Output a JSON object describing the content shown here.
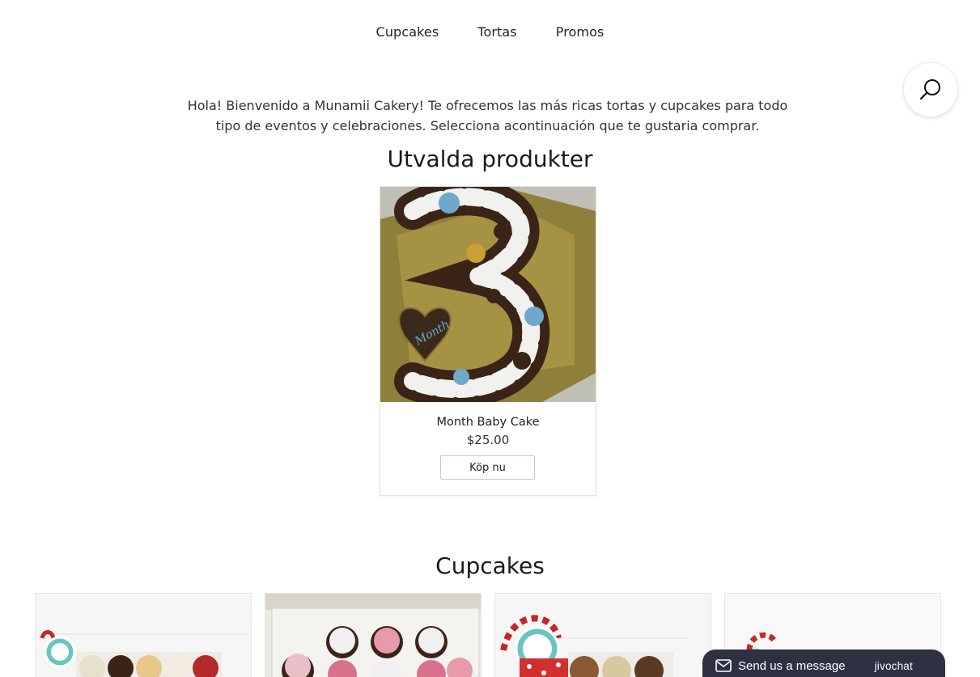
{
  "nav": {
    "items": [
      {
        "label": "Cupcakes"
      },
      {
        "label": "Tortas"
      },
      {
        "label": "Promos"
      }
    ]
  },
  "search": {
    "icon": "search-icon"
  },
  "welcome_text": "Hola! Bienvenido a Munamii Cakery! Te ofrecemos las más ricas tortas y cupcakes para todo tipo de eventos y celebraciones. Selecciona acontinuación que te gustaria comprar.",
  "featured": {
    "title": "Utvalda produkter",
    "product": {
      "name": "Month Baby Cake",
      "price": "$25.00",
      "buy_label": "Köp nu"
    }
  },
  "cupcakes": {
    "title": "Cupcakes"
  },
  "chat": {
    "label": "Send us a message",
    "brand": "jivochat",
    "icon": "envelope-icon"
  },
  "colors": {
    "chat_bg": "#2d3142",
    "text": "#222222"
  }
}
